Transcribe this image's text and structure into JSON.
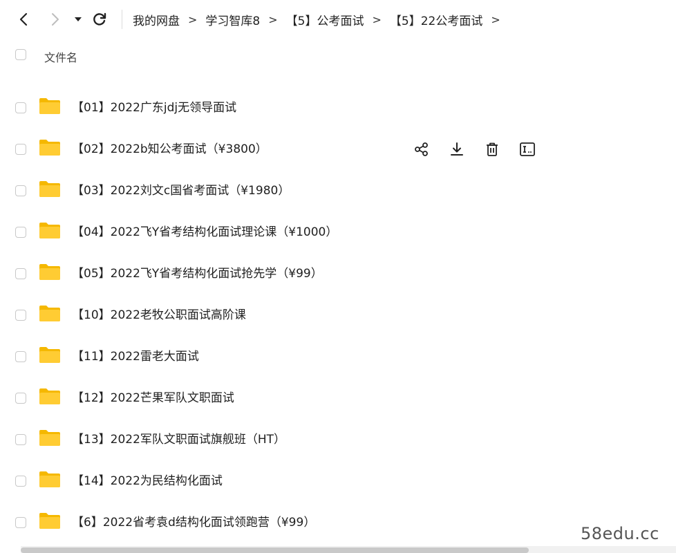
{
  "nav": {
    "back_icon": "chevron-left-icon",
    "forward_icon": "chevron-right-icon",
    "dropdown_icon": "caret-down-icon",
    "refresh_icon": "refresh-icon"
  },
  "breadcrumb": {
    "items": [
      "我的网盘",
      "学习智库8",
      "【5】公考面试",
      "【5】22公考面试"
    ],
    "separator": ">"
  },
  "header": {
    "name_column": "文件名"
  },
  "files": [
    {
      "name": "【01】2022广东jdj无领导面试"
    },
    {
      "name": "【02】2022b知公考面试（¥3800）"
    },
    {
      "name": "【03】2022刘文c国省考面试（¥1980）"
    },
    {
      "name": "【04】2022飞Y省考结构化面试理论课（¥1000）"
    },
    {
      "name": "【05】2022飞Y省考结构化面试抢先学（¥99）"
    },
    {
      "name": "【10】2022老牧公职面试高阶课"
    },
    {
      "name": "【11】2022雷老大面试"
    },
    {
      "name": "【12】2022芒果军队文职面试"
    },
    {
      "name": "【13】2022军队文职面试旗舰班（HT）"
    },
    {
      "name": "【14】2022为民结构化面试"
    },
    {
      "name": "【6】2022省考袁d结构化面试领跑营（¥99）"
    }
  ],
  "row_actions": [
    "share-icon",
    "download-icon",
    "delete-icon",
    "rename-icon"
  ],
  "colors": {
    "folder": "#FFCC33",
    "folder_tab": "#F5B800",
    "icon": "#222222"
  },
  "watermark": "58edu.cc"
}
